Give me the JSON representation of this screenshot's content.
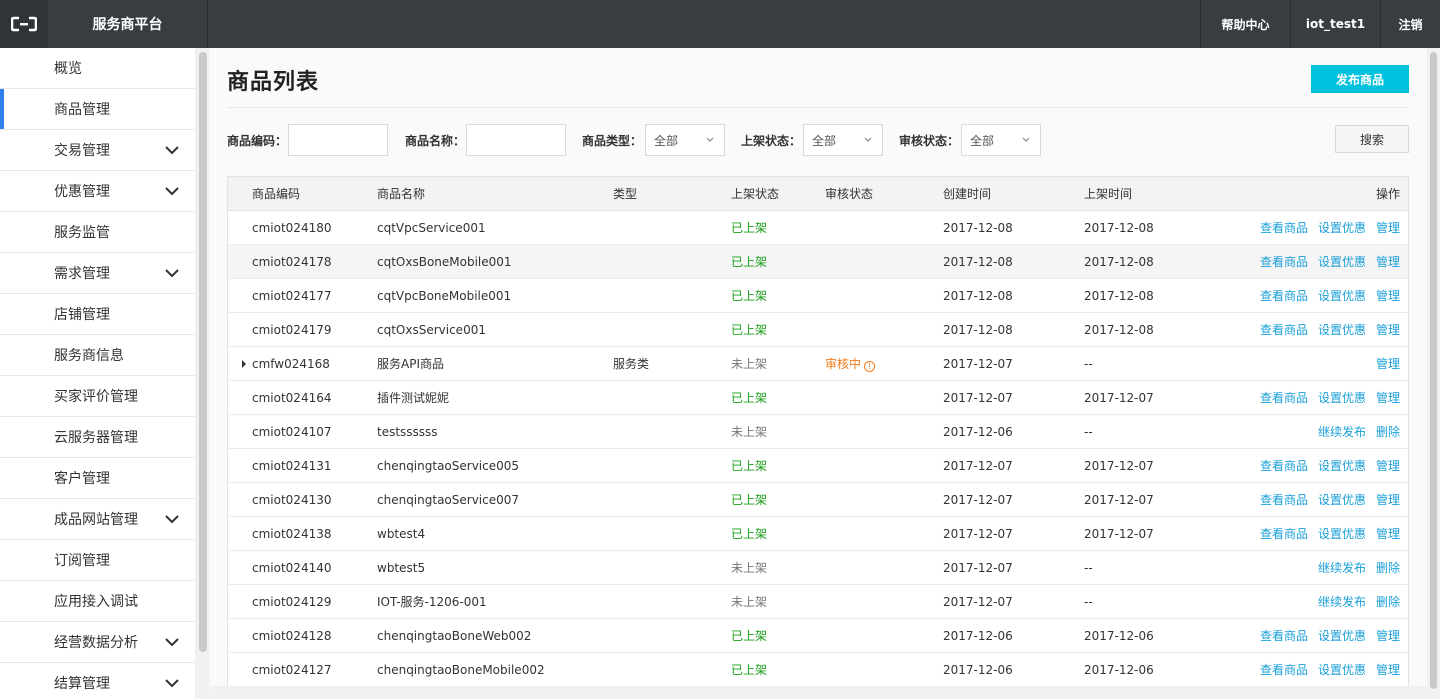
{
  "topbar": {
    "logo_icon": "cloud-bracket-icon",
    "brand": "服务商平台",
    "help": "帮助中心",
    "user": "iot_test1",
    "logout": "注销"
  },
  "sidebar": {
    "items": [
      {
        "label": "概览",
        "expandable": false,
        "active": false
      },
      {
        "label": "商品管理",
        "expandable": false,
        "active": true
      },
      {
        "label": "交易管理",
        "expandable": true,
        "active": false
      },
      {
        "label": "优惠管理",
        "expandable": true,
        "active": false
      },
      {
        "label": "服务监管",
        "expandable": false,
        "active": false
      },
      {
        "label": "需求管理",
        "expandable": true,
        "active": false
      },
      {
        "label": "店铺管理",
        "expandable": false,
        "active": false
      },
      {
        "label": "服务商信息",
        "expandable": false,
        "active": false
      },
      {
        "label": "买家评价管理",
        "expandable": false,
        "active": false
      },
      {
        "label": "云服务器管理",
        "expandable": false,
        "active": false
      },
      {
        "label": "客户管理",
        "expandable": false,
        "active": false
      },
      {
        "label": "成品网站管理",
        "expandable": true,
        "active": false
      },
      {
        "label": "订阅管理",
        "expandable": false,
        "active": false
      },
      {
        "label": "应用接入调试",
        "expandable": false,
        "active": false
      },
      {
        "label": "经营数据分析",
        "expandable": true,
        "active": false
      },
      {
        "label": "结算管理",
        "expandable": true,
        "active": false
      }
    ]
  },
  "main": {
    "title": "商品列表",
    "publish_button": "发布商品",
    "filters": {
      "code_label": "商品编码：",
      "code_value": "",
      "name_label": "商品名称：",
      "name_value": "",
      "type_label": "商品类型：",
      "type_value": "全部",
      "shelf_label": "上架状态：",
      "shelf_value": "全部",
      "audit_label": "审核状态：",
      "audit_value": "全部",
      "search_button": "搜索"
    },
    "table": {
      "headers": {
        "code": "商品编码",
        "name": "商品名称",
        "type": "类型",
        "shelf": "上架状态",
        "audit": "审核状态",
        "created": "创建时间",
        "listed": "上架时间",
        "ops": "操作"
      },
      "rows": [
        {
          "code": "cmiot024180",
          "name": "cqtVpcService001",
          "type": "",
          "shelf": "已上架",
          "shelf_state": "on",
          "audit": "",
          "created": "2017-12-08",
          "listed": "2017-12-08",
          "ops": [
            "查看商品",
            "设置优惠",
            "管理"
          ]
        },
        {
          "code": "cmiot024178",
          "name": "cqtOxsBoneMobile001",
          "type": "",
          "shelf": "已上架",
          "shelf_state": "on",
          "audit": "",
          "created": "2017-12-08",
          "listed": "2017-12-08",
          "ops": [
            "查看商品",
            "设置优惠",
            "管理"
          ]
        },
        {
          "code": "cmiot024177",
          "name": "cqtVpcBoneMobile001",
          "type": "",
          "shelf": "已上架",
          "shelf_state": "on",
          "audit": "",
          "created": "2017-12-08",
          "listed": "2017-12-08",
          "ops": [
            "查看商品",
            "设置优惠",
            "管理"
          ]
        },
        {
          "code": "cmiot024179",
          "name": "cqtOxsService001",
          "type": "",
          "shelf": "已上架",
          "shelf_state": "on",
          "audit": "",
          "created": "2017-12-08",
          "listed": "2017-12-08",
          "ops": [
            "查看商品",
            "设置优惠",
            "管理"
          ]
        },
        {
          "code": "cmfw024168",
          "name": "服务API商品",
          "type": "服务类",
          "shelf": "未上架",
          "shelf_state": "off",
          "audit": "审核中",
          "created": "2017-12-07",
          "listed": "--",
          "ops": [
            "管理"
          ],
          "expandable": true
        },
        {
          "code": "cmiot024164",
          "name": "插件测试妮妮",
          "type": "",
          "shelf": "已上架",
          "shelf_state": "on",
          "audit": "",
          "created": "2017-12-07",
          "listed": "2017-12-07",
          "ops": [
            "查看商品",
            "设置优惠",
            "管理"
          ]
        },
        {
          "code": "cmiot024107",
          "name": "testssssss",
          "type": "",
          "shelf": "未上架",
          "shelf_state": "off",
          "audit": "",
          "created": "2017-12-06",
          "listed": "--",
          "ops": [
            "继续发布",
            "删除"
          ]
        },
        {
          "code": "cmiot024131",
          "name": "chenqingtaoService005",
          "type": "",
          "shelf": "已上架",
          "shelf_state": "on",
          "audit": "",
          "created": "2017-12-07",
          "listed": "2017-12-07",
          "ops": [
            "查看商品",
            "设置优惠",
            "管理"
          ]
        },
        {
          "code": "cmiot024130",
          "name": "chenqingtaoService007",
          "type": "",
          "shelf": "已上架",
          "shelf_state": "on",
          "audit": "",
          "created": "2017-12-07",
          "listed": "2017-12-07",
          "ops": [
            "查看商品",
            "设置优惠",
            "管理"
          ]
        },
        {
          "code": "cmiot024138",
          "name": "wbtest4",
          "type": "",
          "shelf": "已上架",
          "shelf_state": "on",
          "audit": "",
          "created": "2017-12-07",
          "listed": "2017-12-07",
          "ops": [
            "查看商品",
            "设置优惠",
            "管理"
          ]
        },
        {
          "code": "cmiot024140",
          "name": "wbtest5",
          "type": "",
          "shelf": "未上架",
          "shelf_state": "off",
          "audit": "",
          "created": "2017-12-07",
          "listed": "--",
          "ops": [
            "继续发布",
            "删除"
          ]
        },
        {
          "code": "cmiot024129",
          "name": "IOT-服务-1206-001",
          "type": "",
          "shelf": "未上架",
          "shelf_state": "off",
          "audit": "",
          "created": "2017-12-07",
          "listed": "--",
          "ops": [
            "继续发布",
            "删除"
          ]
        },
        {
          "code": "cmiot024128",
          "name": "chenqingtaoBoneWeb002",
          "type": "",
          "shelf": "已上架",
          "shelf_state": "on",
          "audit": "",
          "created": "2017-12-06",
          "listed": "2017-12-06",
          "ops": [
            "查看商品",
            "设置优惠",
            "管理"
          ]
        },
        {
          "code": "cmiot024127",
          "name": "chenqingtaoBoneMobile002",
          "type": "",
          "shelf": "已上架",
          "shelf_state": "on",
          "audit": "",
          "created": "2017-12-06",
          "listed": "2017-12-06",
          "ops": [
            "查看商品",
            "设置优惠",
            "管理"
          ]
        }
      ]
    }
  },
  "colors": {
    "topbar": "#373d41",
    "accent": "#00c1de",
    "active_marker": "#2f80ed",
    "status_on": "#1aa01a",
    "status_audit": "#f07d1a",
    "link": "#1a9fd8"
  }
}
